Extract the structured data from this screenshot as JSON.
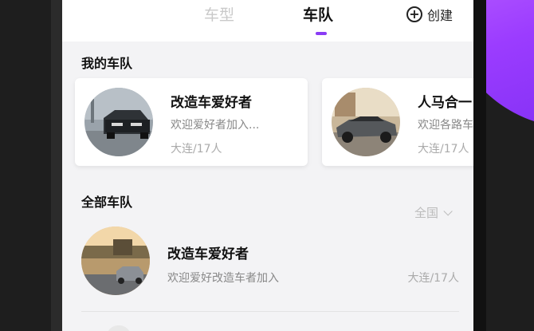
{
  "tabs": {
    "car_type": "车型",
    "team": "车队",
    "create_label": "创建",
    "create_icon": "plus-circle-icon"
  },
  "my_teams": {
    "title": "我的车队",
    "cards": [
      {
        "name": "改造车爱好者",
        "desc": "欢迎爱好者加入...",
        "meta": "大连/17人"
      },
      {
        "name": "人马合一",
        "desc": "欢迎各路车",
        "meta": "大连/17人"
      }
    ]
  },
  "all_teams": {
    "title": "全部车队",
    "region": "全国",
    "items": [
      {
        "name": "改造车爱好者",
        "desc": "欢迎爱好改造车者加入",
        "meta": "大连/17人"
      }
    ]
  },
  "colors": {
    "accent": "#8a3cf5"
  }
}
